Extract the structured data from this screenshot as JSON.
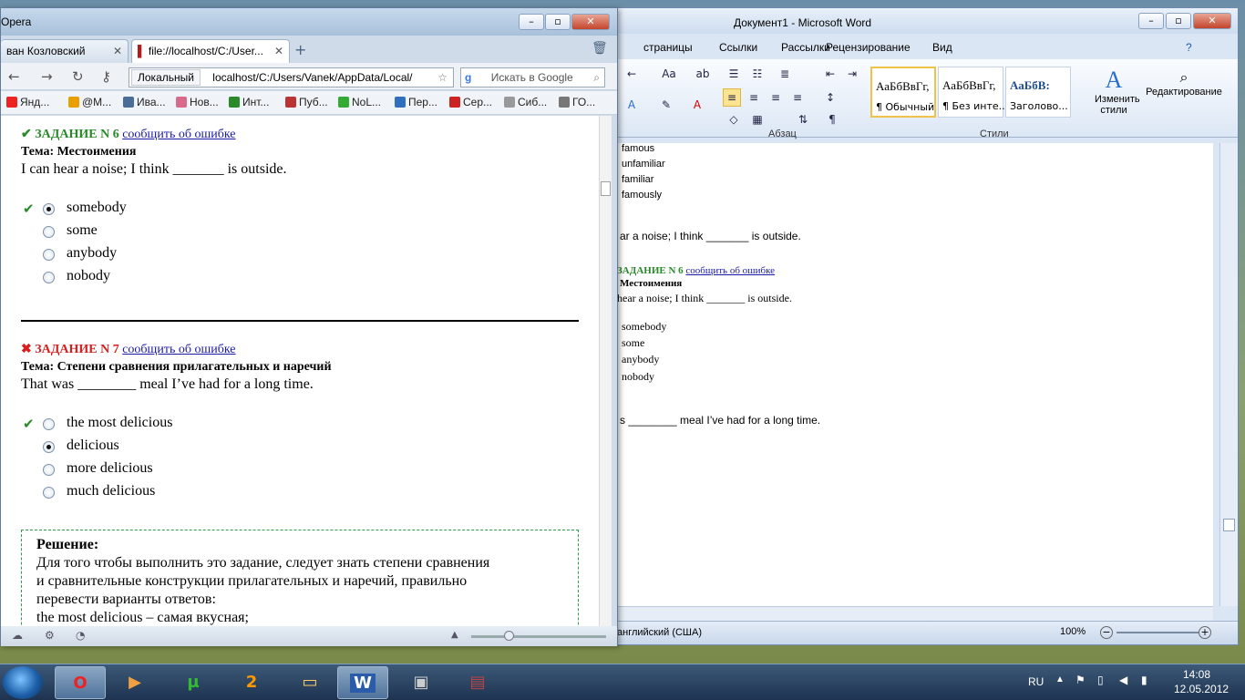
{
  "word": {
    "title": "Документ1  -  Microsoft Word",
    "tabs": [
      "страницы",
      "Ссылки",
      "Рассылки",
      "Рецензирование",
      "Вид"
    ],
    "groups": {
      "paragraph": "Абзац",
      "styles": "Стили"
    },
    "styles": [
      {
        "preview": "АаБбВвГг,",
        "name": "¶ Обычный"
      },
      {
        "preview": "АаБбВвГг,",
        "name": "¶ Без инте..."
      },
      {
        "preview": "АаБбВ:",
        "name": "Заголово..."
      }
    ],
    "change_styles": "Изменить стили",
    "editing": "Редактирование",
    "doc_lines": {
      "w1": "famous",
      "w2": "unfamiliar",
      "w3": "familiar",
      "w4": "famously",
      "hear": "ar a noise; I think _______ is outside.",
      "task_head": "ЗАДАНИЕ N 6",
      "task_link": "сообщить об ошибке",
      "topic": "Местоимения",
      "hear2": "hear a noise; I think _______ is outside.",
      "o1": "somebody",
      "o2": "some",
      "o3": "anybody",
      "o4": "nobody",
      "meal": "s ________ meal I’ve had for a long time."
    },
    "status": {
      "lang": "английский (США)",
      "zoom": "100%"
    }
  },
  "opera": {
    "logo": "Opera",
    "tabs": [
      "ван Козловский",
      "file://localhost/C:/User..."
    ],
    "nav": {
      "local": "Локальный",
      "url": "localhost/C:/Users/Vanek/AppData/Local/",
      "search": "Искать в Google"
    },
    "bookmarks": [
      "Янд...",
      "@M...",
      "Ива...",
      "Нов...",
      "Инт...",
      "Пуб...",
      "NoL...",
      "Пер...",
      "Сер...",
      "Сиб...",
      "ГО..."
    ],
    "q6": {
      "head": "ЗАДАНИЕ N 6",
      "report": "сообщить об ошибке",
      "topic": "Тема: Местоимения",
      "text": "I can hear a noise; I think _______ is outside.",
      "options": [
        "somebody",
        "some",
        "anybody",
        "nobody"
      ]
    },
    "q7": {
      "head": "ЗАДАНИЕ N 7",
      "report": "сообщить об ошибке",
      "topic": "Тема: Степени сравнения прилагательных и наречий",
      "text": "That was ________ meal I’ve had for a long time.",
      "options": [
        "the most delicious",
        "delicious",
        "more delicious",
        "much delicious"
      ]
    },
    "solution": {
      "title": "Решение:",
      "l1": "Для того чтобы выполнить это задание, следует знать степени сравнения",
      "l2": "и сравнительные конструкции прилагательных и наречий, правильно",
      "l3": "перевести варианты ответов:",
      "l4": "the most delicious – самая вкусная;"
    }
  },
  "tray": {
    "lang": "RU",
    "time": "14:08",
    "date": "12.05.2012"
  }
}
